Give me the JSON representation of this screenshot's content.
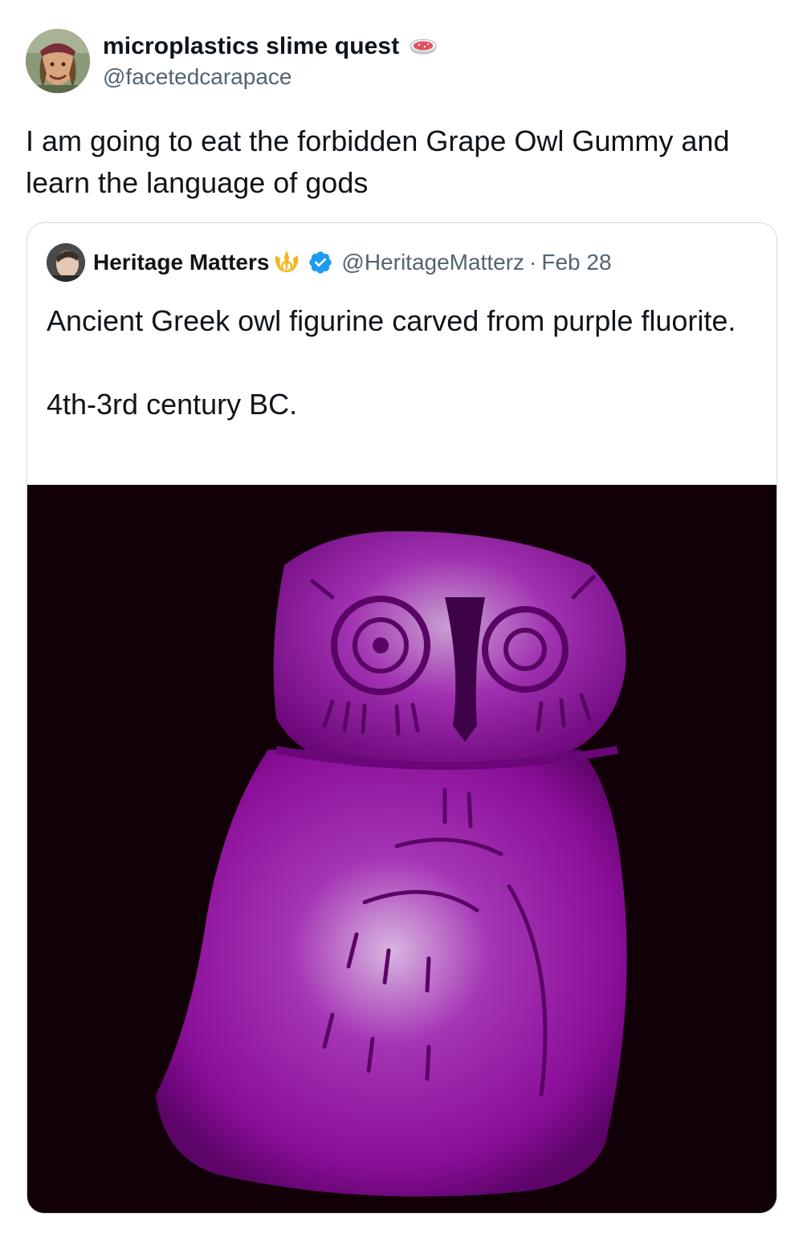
{
  "tweet": {
    "display_name": "microplastics slime quest",
    "handle": "@facetedcarapace",
    "name_emoji": "petri-dish-icon",
    "text": "I am going to eat the forbidden Grape Owl Gummy and learn the language of gods"
  },
  "quote": {
    "display_name": "Heritage Matters",
    "name_emoji": "rebel-alliance-icon",
    "verified_icon": "verified-badge-icon",
    "handle": "@HeritageMatterz",
    "separator": "·",
    "date": "Feb 28",
    "text": "Ancient Greek owl figurine carved from purple fluorite.\n\n4th-3rd century BC."
  },
  "colors": {
    "text_primary": "#0f1419",
    "text_secondary": "#536471",
    "border": "#cfd9de",
    "verified": "#1d9bf0",
    "media_background": "#120008",
    "owl_purple": "#a020b0"
  }
}
